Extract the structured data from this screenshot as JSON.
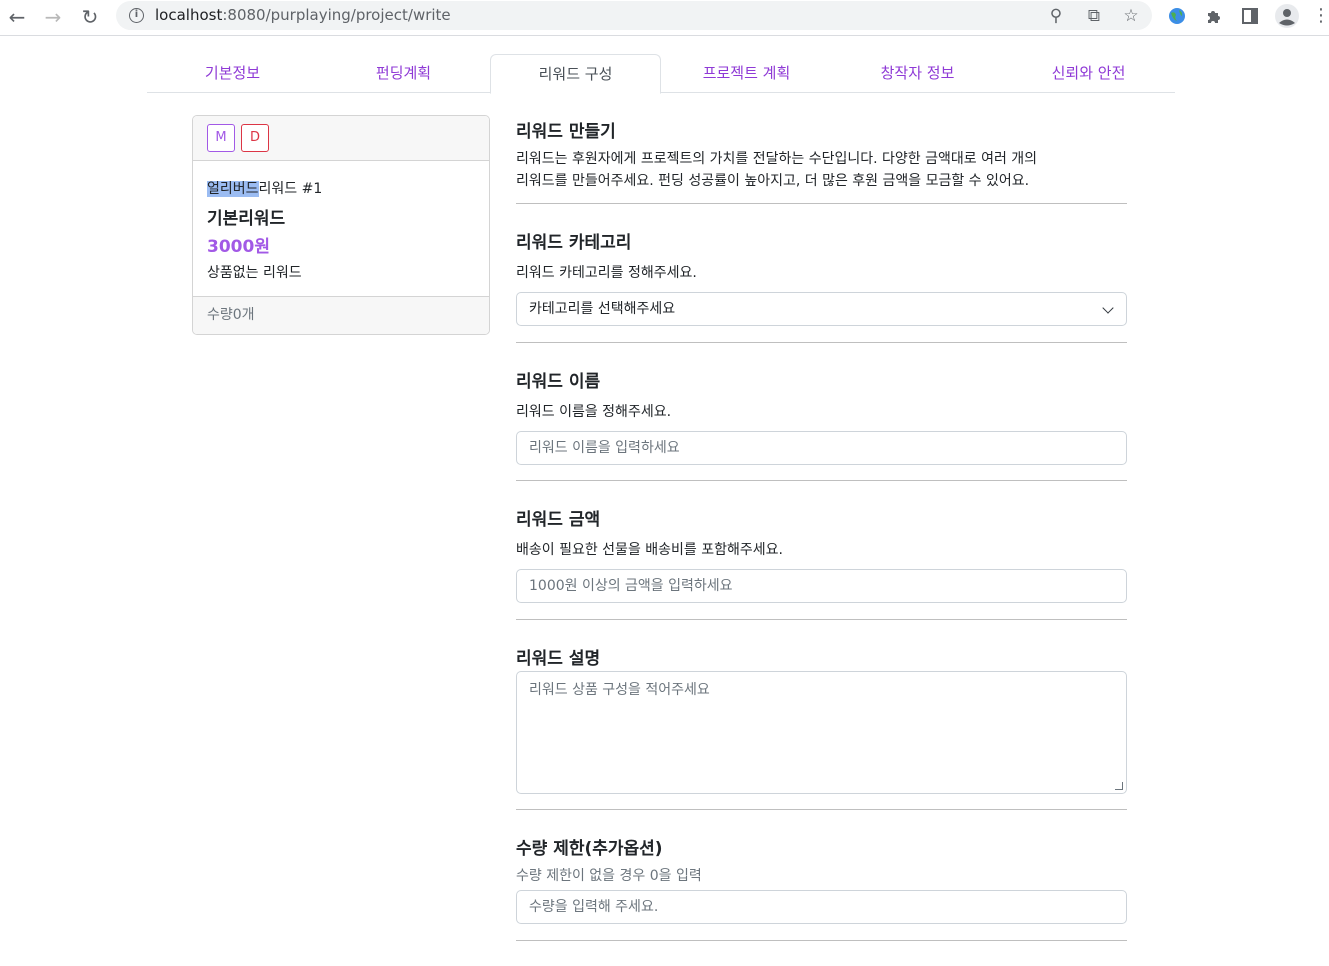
{
  "browser": {
    "url_host": "localhost",
    "url_path": ":8080/purplaying/project/write"
  },
  "tabs": [
    {
      "label": "기본정보",
      "active": false
    },
    {
      "label": "펀딩계획",
      "active": false
    },
    {
      "label": "리워드 구성",
      "active": true
    },
    {
      "label": "프로젝트 계획",
      "active": false
    },
    {
      "label": "창작자 정보",
      "active": false
    },
    {
      "label": "신뢰와 안전",
      "active": false
    }
  ],
  "card": {
    "btn_m": "M",
    "btn_d": "D",
    "order_highlight": "얼리버드",
    "order_rest": "리워드 #1",
    "name": "기본리워드",
    "price": "3000원",
    "desc": "상품없는 리워드",
    "footer": "수량0개"
  },
  "form": {
    "make": {
      "title": "리워드 만들기",
      "line1": "리워드는 후원자에게 프로젝트의 가치를 전달하는 수단입니다. 다양한 금액대로 여러 개의",
      "line2": "리워드를 만들어주세요. 펀딩 성공률이 높아지고, 더 많은 후원 금액을 모금할 수 있어요."
    },
    "category": {
      "title": "리워드 카테고리",
      "sub": "리워드 카테고리를 정해주세요.",
      "selected": "카테고리를 선택해주세요"
    },
    "name": {
      "title": "리워드 이름",
      "sub": "리워드 이름을 정해주세요.",
      "placeholder": "리워드 이름을 입력하세요"
    },
    "price": {
      "title": "리워드 금액",
      "sub": "배송이 필요한 선물을 배송비를 포함해주세요.",
      "placeholder": "1000원 이상의 금액을 입력하세요"
    },
    "desc": {
      "title": "리워드 설명",
      "placeholder": "리워드 상품 구성을 적어주세요"
    },
    "quantity": {
      "title": "수량 제한(추가옵션)",
      "sub": "수량 제한이 없을 경우 0을 입력",
      "placeholder": "수량을 입력해 주세요."
    }
  }
}
